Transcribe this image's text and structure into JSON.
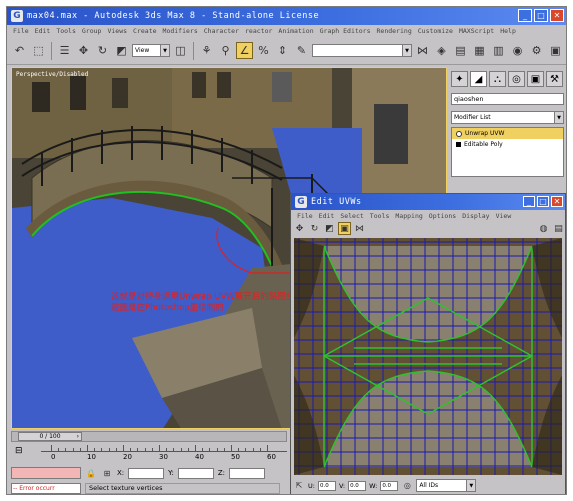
{
  "window": {
    "title": "max04.max - Autodesk 3ds Max 8 - Stand-alone License",
    "icon": "3ds-max-logo-icon",
    "min_label": "_",
    "max_label": "□",
    "close_label": "✕"
  },
  "menu": [
    "File",
    "Edit",
    "Tools",
    "Group",
    "Views",
    "Create",
    "Modifiers",
    "Character",
    "reactor",
    "Animation",
    "Graph Editors",
    "Rendering",
    "Customize",
    "MAXScript",
    "Help"
  ],
  "toolbar": {
    "refcoord_dropdown": "View",
    "selection_set_dropdown": ""
  },
  "viewport": {
    "label": "Perspective/Disabled",
    "colors": {
      "sky": "#3b4a9a",
      "water": "#3e5dc8",
      "stone": "#8a7a5a",
      "accent_line": "#20c020"
    }
  },
  "annotation": {
    "line1": "这就是对桥身运用Unwrap UVW展开后的贴图坐标",
    "line2": "贴图是在Photoshop里绘制的"
  },
  "command_panel": {
    "object_name": "qiaoshen",
    "modifier_list_label": "Modifier List",
    "stack": [
      {
        "label": "Unwrap UVW",
        "selected": true
      },
      {
        "label": "Editable Poly",
        "selected": false
      }
    ]
  },
  "uvw_window": {
    "title": "Edit UVWs",
    "menu": [
      "File",
      "Edit",
      "Select",
      "Tools",
      "Mapping",
      "Options",
      "Display",
      "View"
    ],
    "bottom": {
      "u_label": "U:",
      "u_value": "0.0",
      "v_label": "V:",
      "v_value": "0.0",
      "w_label": "W:",
      "w_value": "0.0",
      "ids_dropdown": "All IDs"
    },
    "colors": {
      "grid": "#1a1ab0",
      "seam": "#30c030",
      "texture": "#6e5a3a"
    }
  },
  "timeline": {
    "frame_counter": "0 / 100",
    "ticks": [
      "0",
      "10",
      "20",
      "30",
      "40",
      "50",
      "60"
    ]
  },
  "status": {
    "x_label": "X:",
    "y_label": "Y:",
    "z_label": "Z:",
    "error_text": "-- Error occurr",
    "prompt": "Select texture vertices"
  }
}
